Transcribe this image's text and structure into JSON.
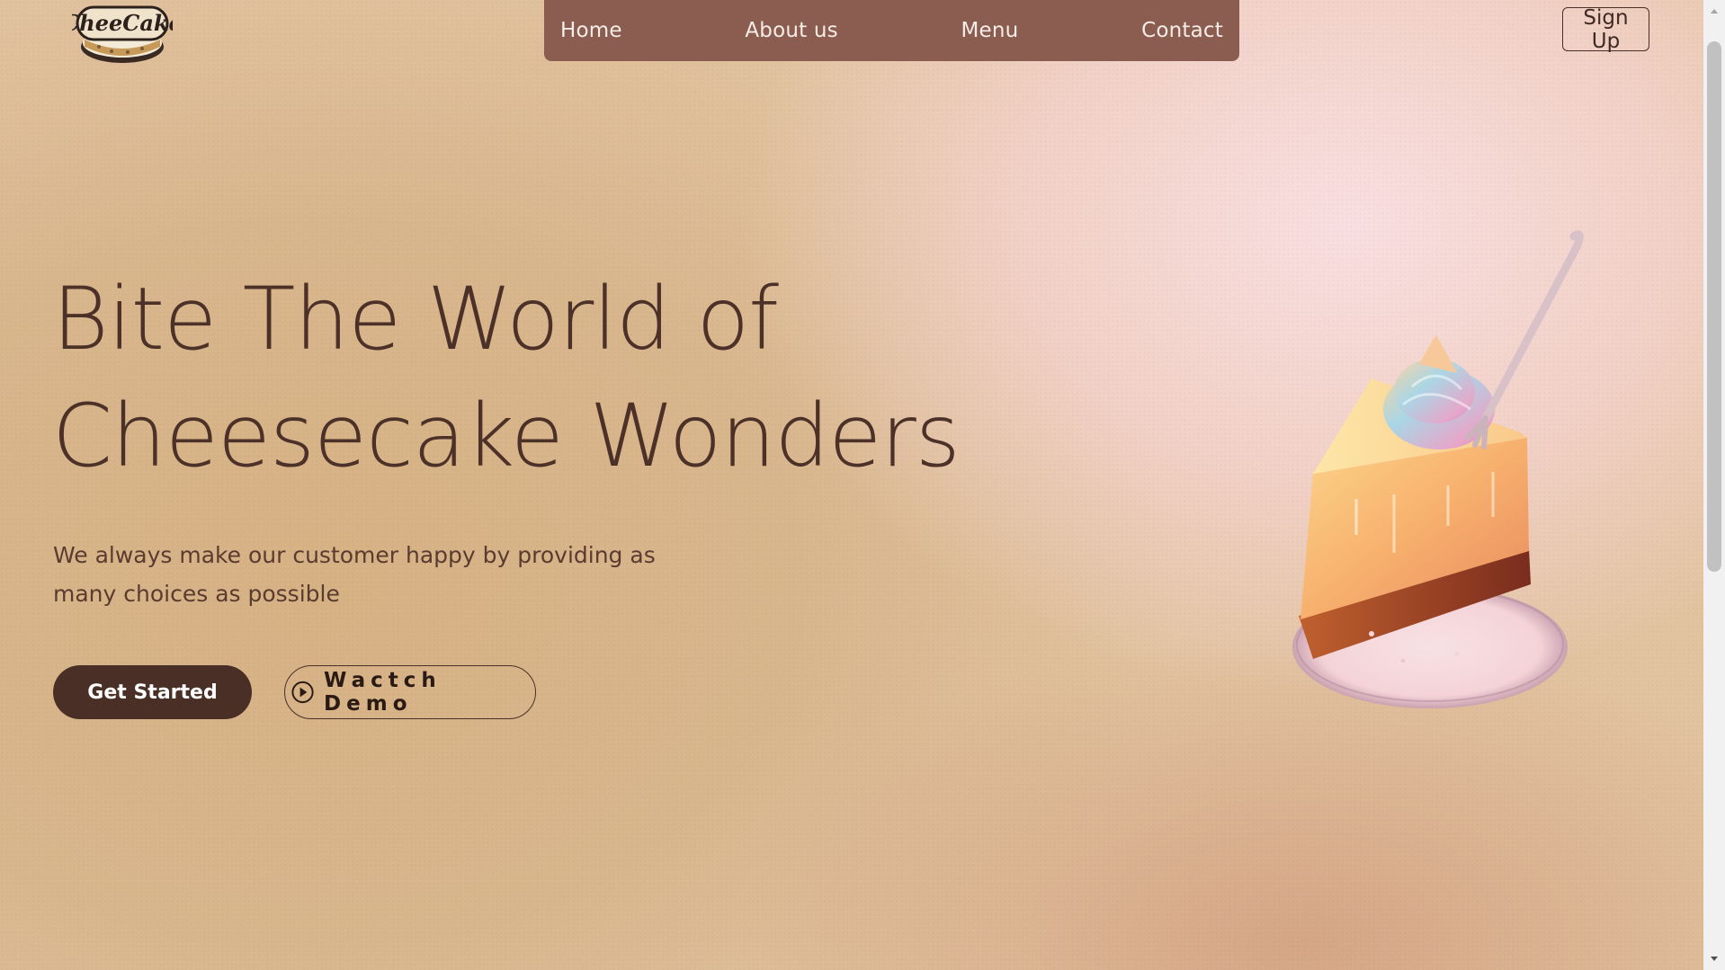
{
  "brand": {
    "logo_text": "CheeCake"
  },
  "nav": {
    "items": [
      {
        "label": "Home"
      },
      {
        "label": "About us"
      },
      {
        "label": "Menu"
      },
      {
        "label": "Contact"
      }
    ]
  },
  "header": {
    "signup_label": "Sign Up"
  },
  "hero": {
    "title_line1": "Bite The World of",
    "title_line2": "Cheesecake Wonders",
    "subtitle": "We always make our customer happy by providing as many choices as possible",
    "primary_button": "Get Started",
    "demo_button": "Wactch Demo"
  },
  "icons": {
    "play": "play-circle-icon",
    "scroll_up": "chevron-up-icon",
    "scroll_down": "chevron-down-icon"
  },
  "colors": {
    "accent": "#4a2f26",
    "nav_bg": "#8b5d50",
    "text": "#4c3128"
  }
}
